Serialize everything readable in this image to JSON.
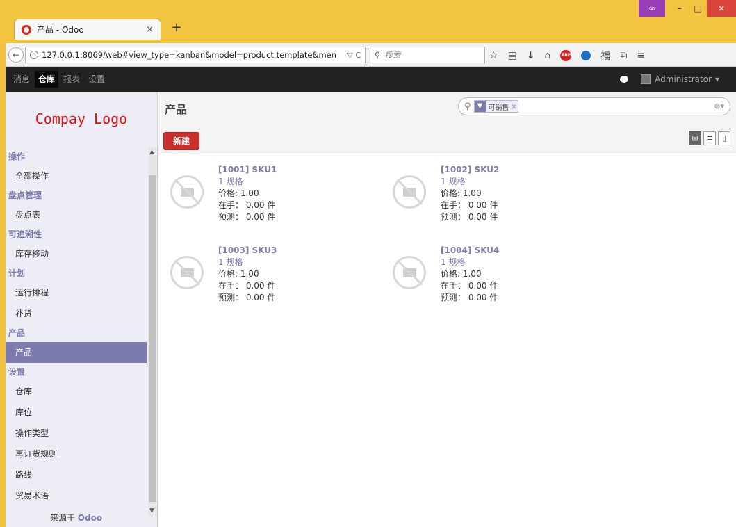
{
  "browser": {
    "tab_title": "产品 - Odoo",
    "tab_close": "×",
    "new_tab": "+",
    "window_controls": {
      "minimize": "–",
      "maximize": "□",
      "close": "×"
    },
    "url": "127.0.0.1:8069/web#view_type=kanban&model=product.template&men",
    "url_suffix": "▽ C",
    "search_placeholder": "搜索",
    "toolbar_icons": [
      "star-icon",
      "reader-icon",
      "download-icon",
      "home-icon",
      "abp-icon",
      "blue-dot-icon",
      "fu-icon",
      "crop-icon",
      "menu-icon"
    ]
  },
  "topmenu": {
    "items": [
      {
        "label": "消息",
        "active": false
      },
      {
        "label": "仓库",
        "active": true
      },
      {
        "label": "报表",
        "active": false
      },
      {
        "label": "设置",
        "active": false
      }
    ],
    "user": "Administrator"
  },
  "sidebar": {
    "logo": "Compay Logo",
    "sections": [
      {
        "title": "操作",
        "items": [
          "全部操作"
        ]
      },
      {
        "title": "盘点管理",
        "items": [
          "盘点表"
        ]
      },
      {
        "title": "可追溯性",
        "items": [
          "库存移动"
        ]
      },
      {
        "title": "计划",
        "items": [
          "运行排程",
          "补货"
        ]
      },
      {
        "title": "产品",
        "items": [
          "产品"
        ]
      },
      {
        "title": "设置",
        "items": [
          "仓库",
          "库位",
          "操作类型",
          "再订货规则",
          "路线",
          "贸易术语"
        ]
      }
    ],
    "active_item": "产品",
    "powered_prefix": "来源于",
    "powered_brand": "Odoo"
  },
  "main": {
    "title": "产品",
    "new_button": "新建",
    "search_facet": "可销售",
    "facet_remove": "x",
    "views": [
      "kanban",
      "list",
      "form"
    ],
    "active_view": "kanban"
  },
  "products": [
    {
      "name": "[1001] SKU1",
      "variants": "1 规格",
      "price": "价格: 1.00",
      "onhand": "在手： 0.00 件",
      "forecast": "预测： 0.00 件"
    },
    {
      "name": "[1002] SKU2",
      "variants": "1 规格",
      "price": "价格: 1.00",
      "onhand": "在手： 0.00 件",
      "forecast": "预测： 0.00 件"
    },
    {
      "name": "[1003] SKU3",
      "variants": "1 规格",
      "price": "价格: 1.00",
      "onhand": "在手： 0.00 件",
      "forecast": "预测： 0.00 件"
    },
    {
      "name": "[1004] SKU4",
      "variants": "1 规格",
      "price": "价格: 1.00",
      "onhand": "在手： 0.00 件",
      "forecast": "预测： 0.00 件"
    }
  ],
  "colors": {
    "brand": "#7c7bad",
    "primary_button": "#c9302c",
    "logo": "#dd1111",
    "firefox_bar": "#f3c43f"
  }
}
